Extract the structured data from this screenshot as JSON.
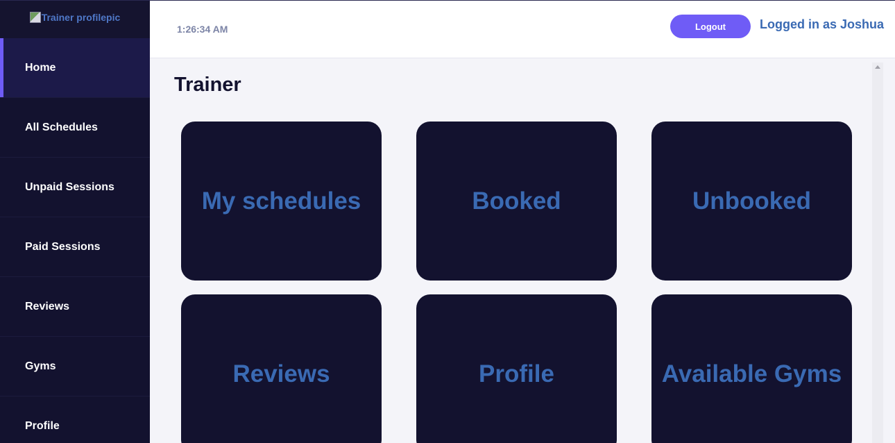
{
  "sidebar": {
    "logo_alt": "Trainer profilepic",
    "items": [
      {
        "label": "Home",
        "active": true
      },
      {
        "label": "All Schedules"
      },
      {
        "label": "Unpaid Sessions"
      },
      {
        "label": "Paid Sessions"
      },
      {
        "label": "Reviews"
      },
      {
        "label": "Gyms"
      },
      {
        "label": "Profile"
      }
    ]
  },
  "header": {
    "time": "1:26:34 AM",
    "logout_label": "Logout",
    "logged_in_text": "Logged in as Joshua"
  },
  "main": {
    "title": "Trainer",
    "cards": [
      {
        "label": "My schedules"
      },
      {
        "label": "Booked"
      },
      {
        "label": "Unbooked"
      },
      {
        "label": "Reviews"
      },
      {
        "label": "Profile"
      },
      {
        "label": "Available Gyms"
      }
    ]
  },
  "colors": {
    "sidebar_bg": "#13122f",
    "accent": "#6f5cf6",
    "card_bg": "#13122f",
    "card_text": "#3a6ab3",
    "main_bg": "#f4f4f9"
  },
  "icons": {
    "logo": "broken-image-icon",
    "scroll_up": "scroll-up-arrow-icon"
  }
}
